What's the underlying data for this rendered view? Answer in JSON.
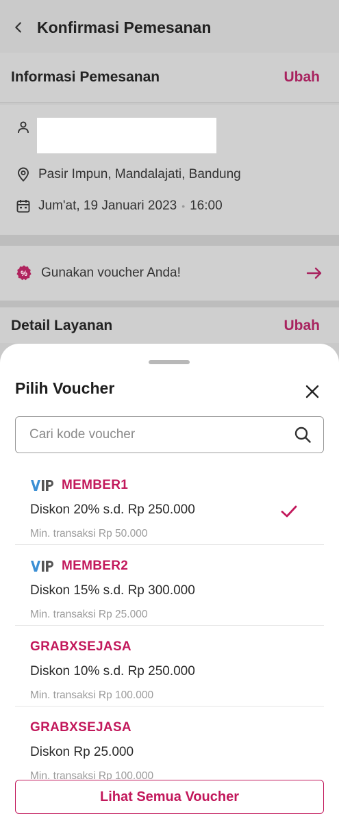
{
  "header": {
    "title": "Konfirmasi Pemesanan"
  },
  "order_info": {
    "title": "Informasi Pemesanan",
    "edit_label": "Ubah",
    "location": "Pasir Impun, Mandalajati, Bandung",
    "date": "Jum'at, 19 Januari 2023",
    "time": "16:00",
    "separator": "•"
  },
  "voucher_prompt": {
    "text": "Gunakan voucher Anda!",
    "badge": "%"
  },
  "service_detail": {
    "title": "Detail Layanan",
    "edit_label": "Ubah"
  },
  "sheet": {
    "title": "Pilih Voucher",
    "search_placeholder": "Cari kode voucher",
    "vouchers": [
      {
        "vip": true,
        "code": "MEMBER1",
        "desc": "Diskon 20% s.d. Rp 250.000",
        "min": "Min. transaksi Rp 50.000",
        "selected": true
      },
      {
        "vip": true,
        "code": "MEMBER2",
        "desc": "Diskon 15% s.d. Rp 300.000",
        "min": "Min. transaksi Rp 25.000",
        "selected": false
      },
      {
        "vip": false,
        "code": "GRABXSEJASA",
        "desc": "Diskon 10% s.d. Rp 250.000",
        "min": "Min. transaksi Rp 100.000",
        "selected": false
      },
      {
        "vip": false,
        "code": "GRABXSEJASA",
        "desc": "Diskon Rp 25.000",
        "min": "Min. transaksi Rp 100.000",
        "selected": false
      }
    ],
    "see_all_label": "Lihat Semua Voucher"
  },
  "colors": {
    "accent": "#c2185b",
    "dim_accent": "#a8235f",
    "vip_blue": "#3b8fd4",
    "vip_gray": "#555555"
  },
  "icons": [
    "back-arrow-icon",
    "person-icon",
    "location-pin-icon",
    "calendar-icon",
    "discount-badge-icon",
    "arrow-right-icon",
    "close-icon",
    "search-icon",
    "vip-logo-icon",
    "check-icon"
  ]
}
